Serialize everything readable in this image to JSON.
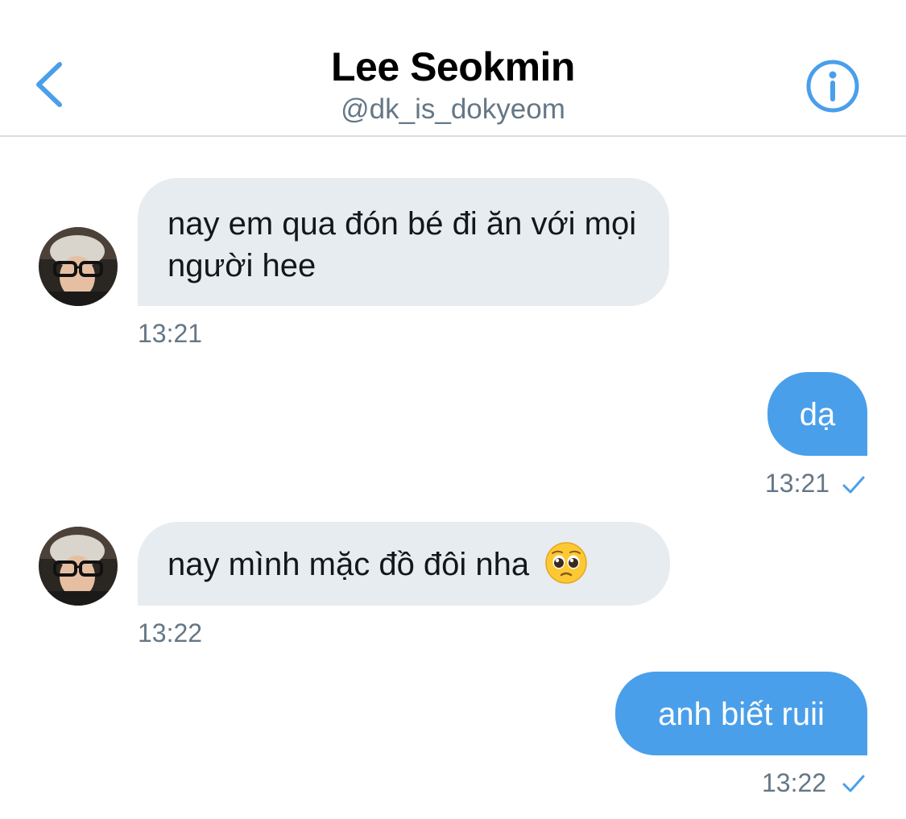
{
  "header": {
    "title": "Lee Seokmin",
    "handle": "@dk_is_dokyeom",
    "back_icon": "chevron-left-icon",
    "info_icon": "info-icon",
    "accent_color": "#4a9fea"
  },
  "messages": [
    {
      "direction": "incoming",
      "text": "nay em qua đón bé đi ăn với mọi người hee",
      "time": "13:21"
    },
    {
      "direction": "outgoing",
      "text": "dạ",
      "time": "13:21",
      "status_icon": "checkmark-icon"
    },
    {
      "direction": "incoming",
      "text": "nay mình mặc đồ đôi nha",
      "emoji": "pleading-face-emoji",
      "time": "13:22"
    },
    {
      "direction": "outgoing",
      "text": "anh biết ruii",
      "time": "13:22",
      "status_icon": "checkmark-icon"
    }
  ],
  "colors": {
    "incoming_bubble": "#e6ecf0",
    "outgoing_bubble": "#4a9fea",
    "secondary_text": "#657786"
  }
}
